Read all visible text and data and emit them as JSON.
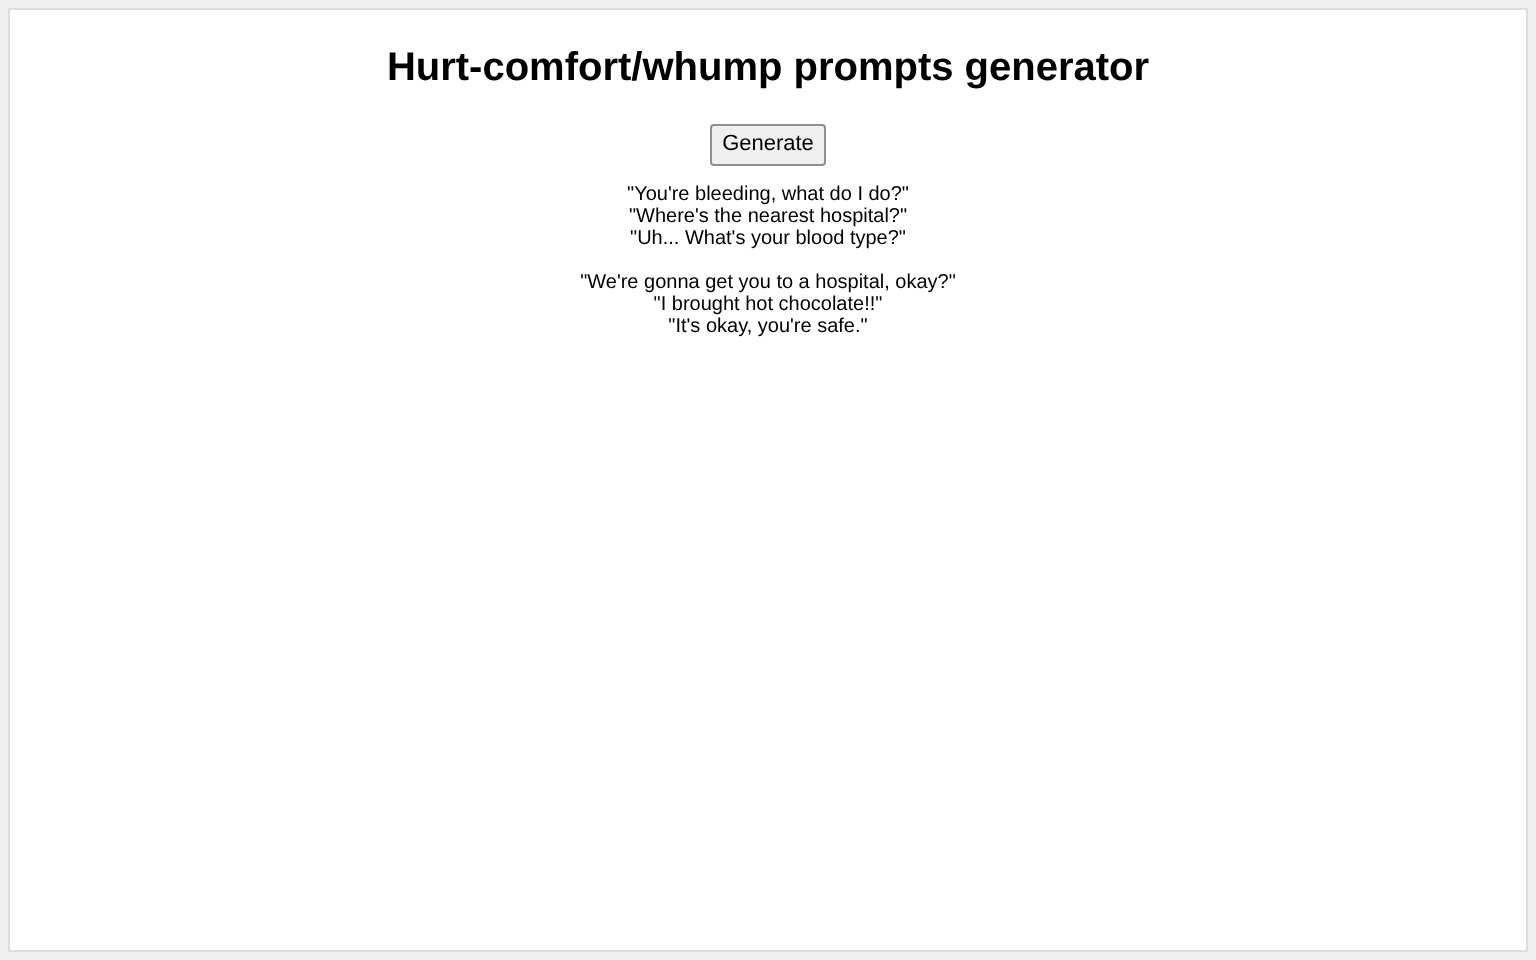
{
  "title": "Hurt-comfort/whump prompts generator",
  "button": "Generate",
  "groups": [
    [
      "\"You're bleeding, what do I do?\"",
      "\"Where's the nearest hospital?\"",
      "\"Uh... What's your blood type?\""
    ],
    [
      "\"We're gonna get you to a hospital, okay?\"",
      "\"I brought hot chocolate!!\"",
      "\"It's okay, you're safe.\""
    ]
  ]
}
